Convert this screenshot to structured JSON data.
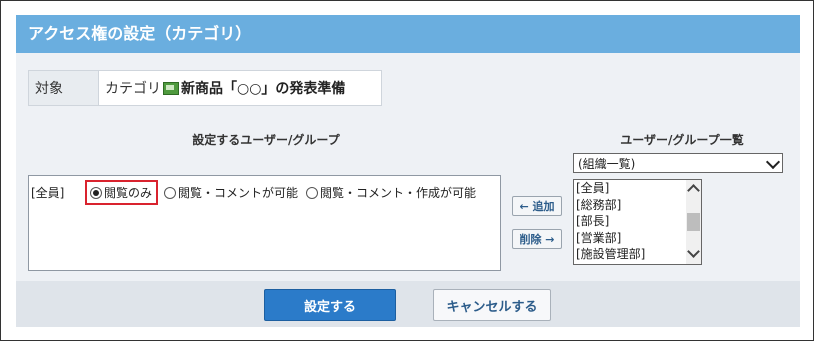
{
  "title": "アクセス権の設定（カテゴリ）",
  "target": {
    "label": "対象",
    "prefix": "カテゴリ",
    "icon": "category-icon",
    "name": "新商品「○○」の発表準備"
  },
  "left_panel": {
    "heading": "設定するユーザー/グループ",
    "rows": [
      {
        "who": "[全員]",
        "options": [
          {
            "label": "閲覧のみ",
            "checked": true
          },
          {
            "label": "閲覧・コメントが可能",
            "checked": false
          },
          {
            "label": "閲覧・コメント・作成が可能",
            "checked": false
          }
        ]
      }
    ]
  },
  "middle_buttons": {
    "add": "← 追加",
    "remove": "削除 →"
  },
  "right_panel": {
    "heading": "ユーザー/グループ一覧",
    "select_value": "(組織一覧)",
    "list": [
      "[全員]",
      "[総務部]",
      "[部長]",
      "[営業部]",
      "[施設管理部]"
    ]
  },
  "footer": {
    "submit": "設定する",
    "cancel": "キャンセルする"
  },
  "colors": {
    "titlebar": "#6aaedf",
    "primary": "#2b7bc9",
    "highlight": "#d9232e"
  }
}
